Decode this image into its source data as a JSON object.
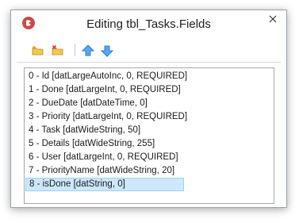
{
  "window": {
    "title": "Editing tbl_Tasks.Fields"
  },
  "toolbar": {
    "buttons": [
      {
        "name": "add-field-button",
        "icon": "folder-add-icon"
      },
      {
        "name": "delete-field-button",
        "icon": "folder-delete-icon"
      },
      {
        "name": "move-up-button",
        "icon": "arrow-up-icon"
      },
      {
        "name": "move-down-button",
        "icon": "arrow-down-icon"
      }
    ]
  },
  "fields": [
    "0 - Id [datLargeAutoInc, 0, REQUIRED]",
    "1 - Done [datLargeInt, 0, REQUIRED]",
    "2 - DueDate [datDateTime, 0]",
    "3 - Priority [datLargeInt, 0, REQUIRED]",
    "4 - Task [datWideString, 50]",
    "5 - Details [datWideString, 255]",
    "6 - User [datLargeInt, 0, REQUIRED]",
    "7 - PriorityName [datWideString, 20]",
    "8 - isDone [datString, 0]"
  ],
  "selected_index": 8,
  "colors": {
    "selection_bg": "#cce8ff",
    "selection_border": "#99d1ff",
    "arrow_blue": "#2f7fd6"
  }
}
